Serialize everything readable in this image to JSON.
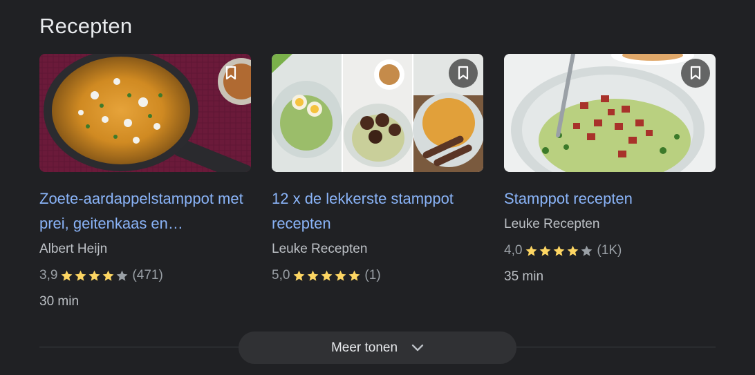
{
  "section": {
    "title": "Recepten"
  },
  "colors": {
    "link": "#8ab4f8",
    "star": "#fdd663",
    "star_empty": "#9aa0a6",
    "background": "#202124"
  },
  "cards": [
    {
      "title": "Zoete-aardappelstamppot met prei, geitenkaas en…",
      "source": "Albert Heijn",
      "rating": "3,9",
      "stars_filled": 4,
      "reviews": "(471)",
      "time": "30 min",
      "bookmark_icon": "bookmark-icon"
    },
    {
      "title": "12 x de lekkerste stamppot recepten",
      "source": "Leuke Recepten",
      "rating": "5,0",
      "stars_filled": 5,
      "reviews": "(1)",
      "time": "",
      "bookmark_icon": "bookmark-icon"
    },
    {
      "title": "Stamppot recepten",
      "source": "Leuke Recepten",
      "rating": "4,0",
      "stars_filled": 4,
      "reviews": "(1K)",
      "time": "35 min",
      "bookmark_icon": "bookmark-icon"
    }
  ],
  "more": {
    "label": "Meer tonen",
    "icon": "chevron-down-icon"
  }
}
